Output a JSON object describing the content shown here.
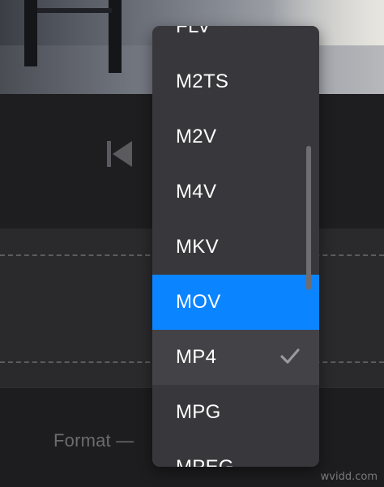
{
  "player": {
    "skip_back_icon": "skip-back-icon"
  },
  "settings": {
    "format_label": "Format —"
  },
  "format_dropdown": {
    "items": [
      {
        "label": "FLV"
      },
      {
        "label": "M2TS"
      },
      {
        "label": "M2V"
      },
      {
        "label": "M4V"
      },
      {
        "label": "MKV"
      },
      {
        "label": "MOV"
      },
      {
        "label": "MP4"
      },
      {
        "label": "MPG"
      },
      {
        "label": "MPEG"
      }
    ],
    "highlighted": "MOV",
    "checked": "MP4",
    "check_icon": "checkmark-icon"
  },
  "colors": {
    "highlight": "#0b84ff",
    "menu_background": "#38383c",
    "checked_row": "#434347"
  },
  "watermark": "wvidd.com"
}
